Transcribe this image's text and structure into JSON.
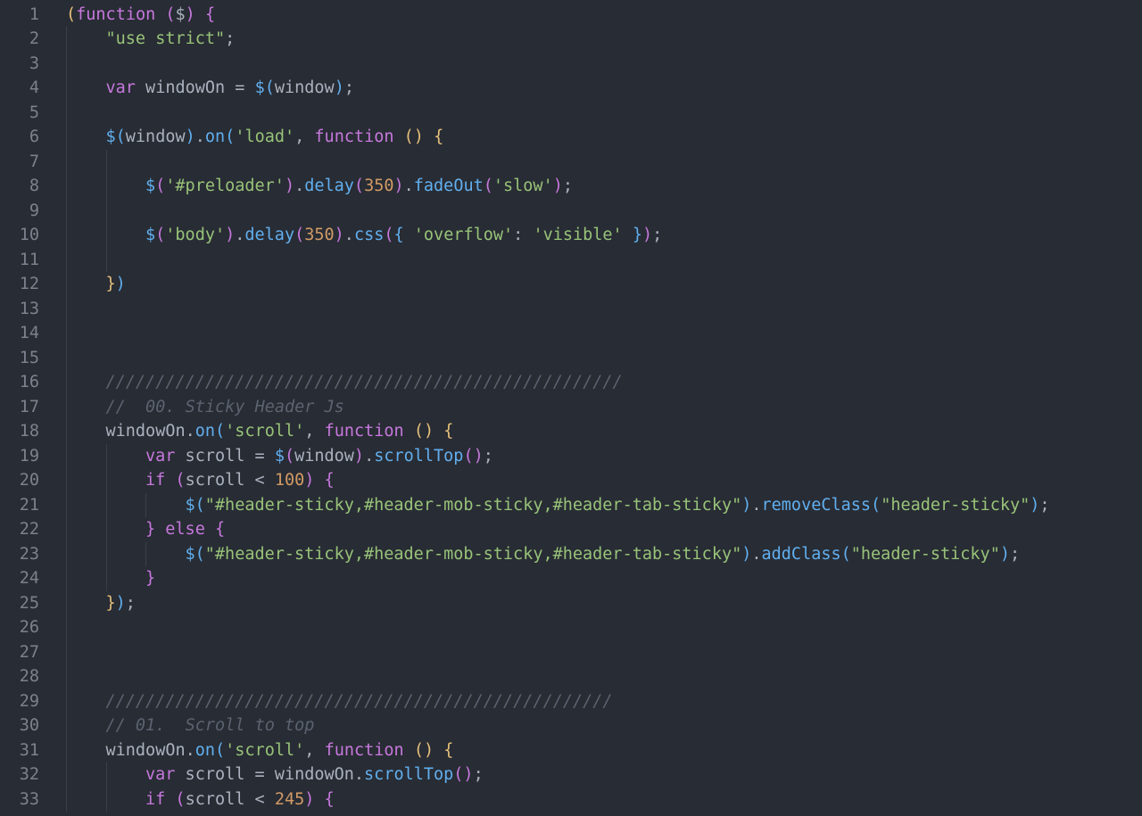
{
  "editor": {
    "theme_colors": {
      "background": "#282c34",
      "line_number": "#7c828d",
      "keyword": "#c678dd",
      "string": "#98c379",
      "function": "#61afef",
      "number": "#d19a66",
      "comment": "#5c6370",
      "bracket_gold": "#e5c07b",
      "text": "#abb2bf"
    },
    "lines": [
      {
        "n": "1",
        "indent": 0,
        "tokens": [
          [
            "p1",
            "("
          ],
          [
            "kw",
            "function"
          ],
          [
            "plain",
            " "
          ],
          [
            "p2",
            "("
          ],
          [
            "plain",
            "$"
          ],
          [
            "p2",
            ")"
          ],
          [
            "plain",
            " "
          ],
          [
            "p2",
            "{"
          ]
        ]
      },
      {
        "n": "2",
        "indent": 1,
        "tokens": [
          [
            "str",
            "\"use strict\""
          ],
          [
            "plain",
            ";"
          ]
        ]
      },
      {
        "n": "3",
        "indent": 1,
        "tokens": []
      },
      {
        "n": "4",
        "indent": 1,
        "tokens": [
          [
            "kw",
            "var"
          ],
          [
            "plain",
            " windowOn = "
          ],
          [
            "fn",
            "$"
          ],
          [
            "p3",
            "("
          ],
          [
            "plain",
            "window"
          ],
          [
            "p3",
            ")"
          ],
          [
            "plain",
            ";"
          ]
        ]
      },
      {
        "n": "5",
        "indent": 1,
        "tokens": []
      },
      {
        "n": "6",
        "indent": 1,
        "tokens": [
          [
            "fn",
            "$"
          ],
          [
            "p3",
            "("
          ],
          [
            "plain",
            "window"
          ],
          [
            "p3",
            ")"
          ],
          [
            "plain",
            "."
          ],
          [
            "fn",
            "on"
          ],
          [
            "p3",
            "("
          ],
          [
            "str",
            "'load'"
          ],
          [
            "plain",
            ", "
          ],
          [
            "kw",
            "function"
          ],
          [
            "plain",
            " "
          ],
          [
            "p1",
            "()"
          ],
          [
            "plain",
            " "
          ],
          [
            "p1",
            "{"
          ]
        ]
      },
      {
        "n": "7",
        "indent": 2,
        "tokens": []
      },
      {
        "n": "8",
        "indent": 2,
        "tokens": [
          [
            "fn",
            "$"
          ],
          [
            "p2",
            "("
          ],
          [
            "str",
            "'#preloader'"
          ],
          [
            "p2",
            ")"
          ],
          [
            "plain",
            "."
          ],
          [
            "fn",
            "delay"
          ],
          [
            "p2",
            "("
          ],
          [
            "num",
            "350"
          ],
          [
            "p2",
            ")"
          ],
          [
            "plain",
            "."
          ],
          [
            "fn",
            "fadeOut"
          ],
          [
            "p2",
            "("
          ],
          [
            "str",
            "'slow'"
          ],
          [
            "p2",
            ")"
          ],
          [
            "plain",
            ";"
          ]
        ]
      },
      {
        "n": "9",
        "indent": 2,
        "tokens": []
      },
      {
        "n": "10",
        "indent": 2,
        "tokens": [
          [
            "fn",
            "$"
          ],
          [
            "p2",
            "("
          ],
          [
            "str",
            "'body'"
          ],
          [
            "p2",
            ")"
          ],
          [
            "plain",
            "."
          ],
          [
            "fn",
            "delay"
          ],
          [
            "p2",
            "("
          ],
          [
            "num",
            "350"
          ],
          [
            "p2",
            ")"
          ],
          [
            "plain",
            "."
          ],
          [
            "fn",
            "css"
          ],
          [
            "p2",
            "("
          ],
          [
            "p3",
            "{"
          ],
          [
            "plain",
            " "
          ],
          [
            "str",
            "'overflow'"
          ],
          [
            "plain",
            ": "
          ],
          [
            "str",
            "'visible'"
          ],
          [
            "plain",
            " "
          ],
          [
            "p3",
            "}"
          ],
          [
            "p2",
            ")"
          ],
          [
            "plain",
            ";"
          ]
        ]
      },
      {
        "n": "11",
        "indent": 2,
        "tokens": []
      },
      {
        "n": "12",
        "indent": 1,
        "tokens": [
          [
            "p1",
            "}"
          ],
          [
            "p3",
            ")"
          ]
        ]
      },
      {
        "n": "13",
        "indent": 1,
        "tokens": []
      },
      {
        "n": "14",
        "indent": 1,
        "tokens": []
      },
      {
        "n": "15",
        "indent": 1,
        "tokens": []
      },
      {
        "n": "16",
        "indent": 1,
        "tokens": [
          [
            "cm",
            "////////////////////////////////////////////////////"
          ]
        ]
      },
      {
        "n": "17",
        "indent": 1,
        "tokens": [
          [
            "cm",
            "//  00. Sticky Header Js"
          ]
        ]
      },
      {
        "n": "18",
        "indent": 1,
        "tokens": [
          [
            "plain",
            "windowOn."
          ],
          [
            "fn",
            "on"
          ],
          [
            "p3",
            "("
          ],
          [
            "str",
            "'scroll'"
          ],
          [
            "plain",
            ", "
          ],
          [
            "kw",
            "function"
          ],
          [
            "plain",
            " "
          ],
          [
            "p1",
            "()"
          ],
          [
            "plain",
            " "
          ],
          [
            "p1",
            "{"
          ]
        ]
      },
      {
        "n": "19",
        "indent": 2,
        "tokens": [
          [
            "kw",
            "var"
          ],
          [
            "plain",
            " scroll = "
          ],
          [
            "fn",
            "$"
          ],
          [
            "p2",
            "("
          ],
          [
            "plain",
            "window"
          ],
          [
            "p2",
            ")"
          ],
          [
            "plain",
            "."
          ],
          [
            "fn",
            "scrollTop"
          ],
          [
            "p2",
            "()"
          ],
          [
            "plain",
            ";"
          ]
        ]
      },
      {
        "n": "20",
        "indent": 2,
        "tokens": [
          [
            "kw",
            "if"
          ],
          [
            "plain",
            " "
          ],
          [
            "p2",
            "("
          ],
          [
            "plain",
            "scroll < "
          ],
          [
            "num",
            "100"
          ],
          [
            "p2",
            ")"
          ],
          [
            "plain",
            " "
          ],
          [
            "p2",
            "{"
          ]
        ]
      },
      {
        "n": "21",
        "indent": 3,
        "tokens": [
          [
            "fn",
            "$"
          ],
          [
            "p3",
            "("
          ],
          [
            "str",
            "\"#header-sticky,#header-mob-sticky,#header-tab-sticky\""
          ],
          [
            "p3",
            ")"
          ],
          [
            "plain",
            "."
          ],
          [
            "fn",
            "removeClass"
          ],
          [
            "p3",
            "("
          ],
          [
            "str",
            "\"header-sticky\""
          ],
          [
            "p3",
            ")"
          ],
          [
            "plain",
            ";"
          ]
        ]
      },
      {
        "n": "22",
        "indent": 2,
        "tokens": [
          [
            "p2",
            "}"
          ],
          [
            "plain",
            " "
          ],
          [
            "kw",
            "else"
          ],
          [
            "plain",
            " "
          ],
          [
            "p2",
            "{"
          ]
        ]
      },
      {
        "n": "23",
        "indent": 3,
        "tokens": [
          [
            "fn",
            "$"
          ],
          [
            "p3",
            "("
          ],
          [
            "str",
            "\"#header-sticky,#header-mob-sticky,#header-tab-sticky\""
          ],
          [
            "p3",
            ")"
          ],
          [
            "plain",
            "."
          ],
          [
            "fn",
            "addClass"
          ],
          [
            "p3",
            "("
          ],
          [
            "str",
            "\"header-sticky\""
          ],
          [
            "p3",
            ")"
          ],
          [
            "plain",
            ";"
          ]
        ]
      },
      {
        "n": "24",
        "indent": 2,
        "tokens": [
          [
            "p2",
            "}"
          ]
        ]
      },
      {
        "n": "25",
        "indent": 1,
        "tokens": [
          [
            "p1",
            "}"
          ],
          [
            "p3",
            ")"
          ],
          [
            "plain",
            ";"
          ]
        ]
      },
      {
        "n": "26",
        "indent": 1,
        "tokens": []
      },
      {
        "n": "27",
        "indent": 1,
        "tokens": []
      },
      {
        "n": "28",
        "indent": 1,
        "tokens": []
      },
      {
        "n": "29",
        "indent": 1,
        "tokens": [
          [
            "cm",
            "///////////////////////////////////////////////////"
          ]
        ]
      },
      {
        "n": "30",
        "indent": 1,
        "tokens": [
          [
            "cm",
            "// 01.  Scroll to top"
          ]
        ]
      },
      {
        "n": "31",
        "indent": 1,
        "tokens": [
          [
            "plain",
            "windowOn."
          ],
          [
            "fn",
            "on"
          ],
          [
            "p3",
            "("
          ],
          [
            "str",
            "'scroll'"
          ],
          [
            "plain",
            ", "
          ],
          [
            "kw",
            "function"
          ],
          [
            "plain",
            " "
          ],
          [
            "p1",
            "()"
          ],
          [
            "plain",
            " "
          ],
          [
            "p1",
            "{"
          ]
        ]
      },
      {
        "n": "32",
        "indent": 2,
        "tokens": [
          [
            "kw",
            "var"
          ],
          [
            "plain",
            " scroll = windowOn."
          ],
          [
            "fn",
            "scrollTop"
          ],
          [
            "p2",
            "()"
          ],
          [
            "plain",
            ";"
          ]
        ]
      },
      {
        "n": "33",
        "indent": 2,
        "tokens": [
          [
            "kw",
            "if"
          ],
          [
            "plain",
            " "
          ],
          [
            "p2",
            "("
          ],
          [
            "plain",
            "scroll < "
          ],
          [
            "num",
            "245"
          ],
          [
            "p2",
            ")"
          ],
          [
            "plain",
            " "
          ],
          [
            "p2",
            "{"
          ]
        ]
      }
    ]
  }
}
